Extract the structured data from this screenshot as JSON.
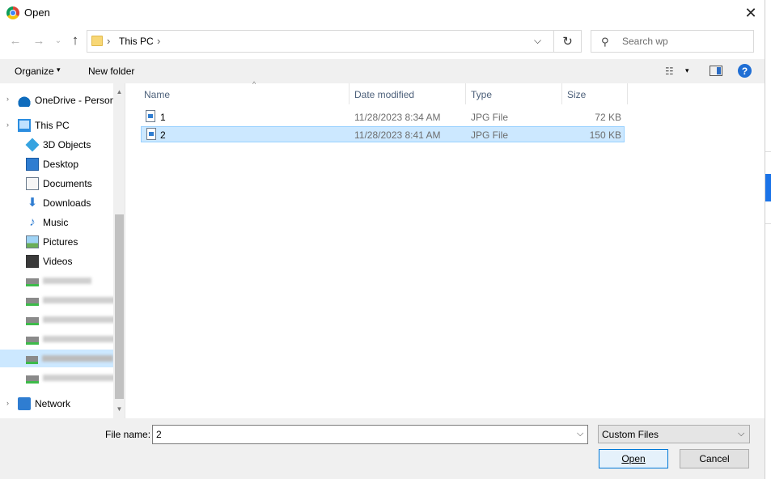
{
  "window": {
    "title": "Open",
    "close_glyph": "✕"
  },
  "address": {
    "back_glyph": "←",
    "forward_glyph": "→",
    "recent_glyph": "⌄",
    "up_glyph": "↑",
    "sep_glyph": "›",
    "crumb": "This PC",
    "dropdown_glyph": "⌵",
    "refresh_glyph": "↻",
    "search_placeholder": "Search wp",
    "search_glyph": "⚲"
  },
  "commandbar": {
    "organize": "Organize",
    "caret": "▾",
    "new_folder": "New folder",
    "view_glyph": "☷",
    "help_glyph": "?"
  },
  "navpane": {
    "expander": "›",
    "items": [
      {
        "label": "OneDrive - Person",
        "icon": "cloud-icon"
      },
      {
        "label": "This PC",
        "icon": "computer-icon"
      },
      {
        "label": "3D Objects",
        "icon": "3d-objects-icon"
      },
      {
        "label": "Desktop",
        "icon": "desktop-icon"
      },
      {
        "label": "Documents",
        "icon": "documents-icon"
      },
      {
        "label": "Downloads",
        "icon": "downloads-icon"
      },
      {
        "label": "Music",
        "icon": "music-icon"
      },
      {
        "label": "Pictures",
        "icon": "pictures-icon"
      },
      {
        "label": "Videos",
        "icon": "videos-icon"
      },
      {
        "label": "Network",
        "icon": "network-icon"
      }
    ],
    "down_glyph": "⬇",
    "music_glyph": "♪",
    "scroll_up": "▲",
    "scroll_down": "▼"
  },
  "filelist": {
    "sort_caret": "^",
    "columns": [
      "Name",
      "Date modified",
      "Type",
      "Size"
    ],
    "rows": [
      {
        "name": "1",
        "date": "11/28/2023 8:34 AM",
        "type": "JPG File",
        "size": "72 KB"
      },
      {
        "name": "2",
        "date": "11/28/2023 8:41 AM",
        "type": "JPG File",
        "size": "150 KB"
      }
    ]
  },
  "bottom": {
    "filename_label": "File name:",
    "filename_value": "2",
    "filename_caret": "⌵",
    "filter": "Custom Files",
    "filter_caret": "⌵",
    "open": "Open",
    "cancel": "Cancel"
  },
  "colors": {
    "selection": "#cce8ff",
    "accent": "#0078d7"
  }
}
